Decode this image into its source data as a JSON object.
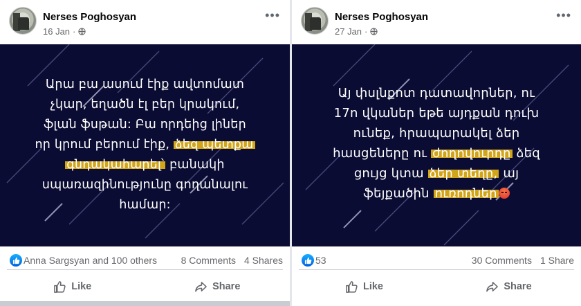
{
  "posts": [
    {
      "author": "Nerses Poghosyan",
      "date": "16 Jan",
      "more": "•••",
      "text_lines": [
        "Արա բա ասում էիք ավտոմատ",
        "չկար, եղածն էլ բեր կրակում,",
        "ֆլան ֆսթան: Բա որդեից լիներ",
        "որ կրում բերում էիք, ",
        "գնդակահարել՝ բանակի",
        "սպառազինությունը գողանալու",
        "համար:"
      ],
      "highlight_1": "ձեզ պետքա",
      "highlight_2": "գնդակահարել՝",
      "line5_rest": "բանակի",
      "reactions_text": "Anna Sargsyan and 100 others",
      "comments": "8 Comments",
      "shares": "4 Shares",
      "like_label": "Like",
      "share_label": "Share"
    },
    {
      "author": "Nerses Poghosyan",
      "date": "27 Jan",
      "more": "•••",
      "line1": "Այ փսլնքոտ դատավորներ, ու",
      "line2": "17ո վկաներ եթե այդքան դուխ",
      "line3": "ունեք, հրապարակել ձեր",
      "line4_a": "հասցեները ու ",
      "line4_hl": "ժողովուրդը",
      "line4_b": " ձեզ",
      "line5_a": "ցույց կտա ",
      "line5_hl": "ձեր տեղը,",
      "line5_b": " այ",
      "line6_a": "ֆեյքածին ",
      "line6_hl": "ուռոդներ",
      "reactions_text": "53",
      "comments": "30 Comments",
      "shares": "1 Share",
      "like_label": "Like",
      "share_label": "Share"
    }
  ],
  "icons": {
    "like": "thumbs-up-icon",
    "share": "share-arrow-icon",
    "privacy": "globe-icon",
    "emoji": "angry-face-emoji"
  },
  "colors": {
    "media_bg": "#0b0c33",
    "highlight": "#d1a41a",
    "like_blue": "#1877f2",
    "muted": "#65676b"
  }
}
